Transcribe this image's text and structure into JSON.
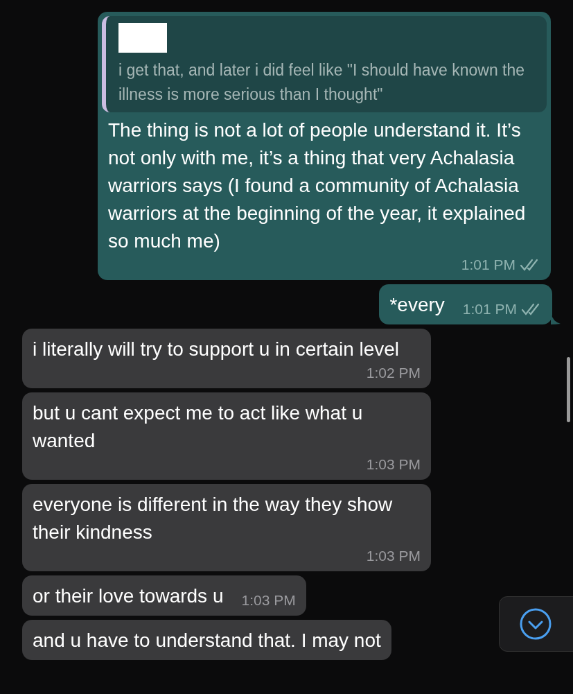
{
  "messages": [
    {
      "kind": "sent",
      "quote": {
        "author_redacted": true,
        "text": "i get that, and later i did feel like \"I should have known the illness is more serious than I thought\""
      },
      "text": "The thing is not a lot of people understand it. It’s not only with me, it’s a thing that very Achalasia warriors says (I found a community of Achalasia warriors at the beginning of the year, it explained so much me)",
      "time": "1:01 PM",
      "read": false,
      "tail": false
    },
    {
      "kind": "sent",
      "text": "*every",
      "time": "1:01 PM",
      "read": false,
      "tail": true
    },
    {
      "kind": "received",
      "text": "i literally will try to support u in certain level",
      "time": "1:02 PM",
      "tail": false
    },
    {
      "kind": "received",
      "text": "but u cant expect me to act like what u wanted",
      "time": "1:03 PM",
      "tail": false
    },
    {
      "kind": "received",
      "text": "everyone is different in the way they show their kindness",
      "time": "1:03 PM",
      "tail": false
    },
    {
      "kind": "received",
      "text": "or their love towards u",
      "time": "1:03 PM",
      "tail": false
    },
    {
      "kind": "received",
      "text": "and u have to understand that. I may not",
      "tail": false
    }
  ]
}
